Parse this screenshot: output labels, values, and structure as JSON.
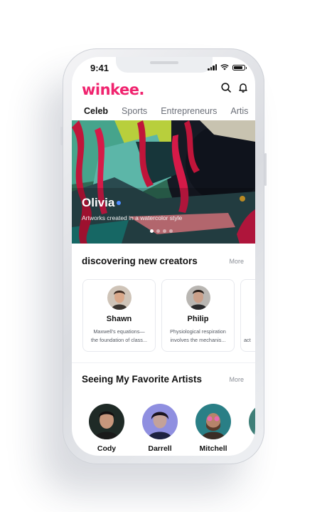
{
  "status_bar": {
    "time": "9:41"
  },
  "app": {
    "logo": "winkee.",
    "brand_color": "#f0246f"
  },
  "header_icons": [
    "search-icon",
    "bell-icon"
  ],
  "tabs": [
    {
      "label": "Celeb",
      "active": true
    },
    {
      "label": "Sports",
      "active": false
    },
    {
      "label": "Entrepreneurs",
      "active": false
    },
    {
      "label": "Artis",
      "active": false
    }
  ],
  "hero": {
    "title": "Olivia",
    "subtitle": "Artworks created in a watercolor style",
    "carousel_index": 1,
    "carousel_count": 4
  },
  "creators": {
    "title": "discovering new creators",
    "more": "More",
    "cards": [
      {
        "name": "Shawn",
        "desc_line1": "Maxwell's equations—",
        "desc_line2": "the foundation of class..."
      },
      {
        "name": "Philip",
        "desc_line1": "Physiological respiration",
        "desc_line2": "involves the mechanis..."
      },
      {
        "name": "",
        "desc_line1": "",
        "desc_line2": "act"
      }
    ]
  },
  "artists": {
    "title": "Seeing My Favorite Artists",
    "more": "More",
    "items": [
      {
        "name": "Cody"
      },
      {
        "name": "Darrell"
      },
      {
        "name": "Mitchell"
      },
      {
        "name": ""
      }
    ]
  }
}
